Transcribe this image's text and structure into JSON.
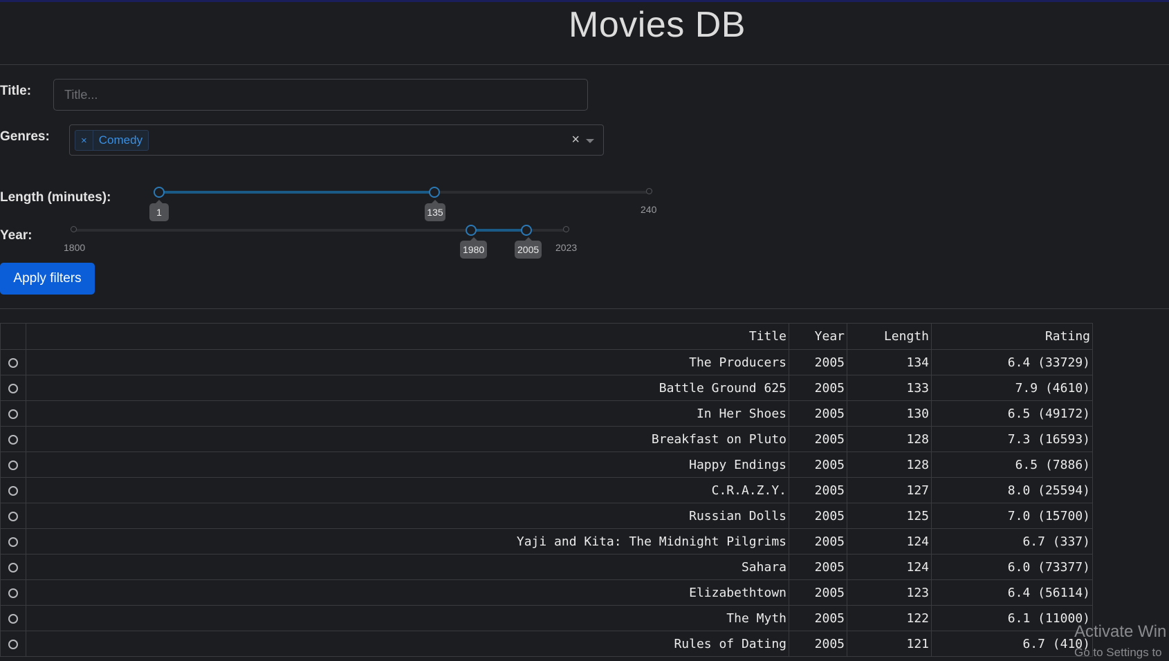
{
  "app": {
    "title": "Movies DB"
  },
  "filters": {
    "title_label": "Title:",
    "title_value": "",
    "title_placeholder": "Title...",
    "genres_label": "Genres:",
    "genres_selected": [
      "Comedy"
    ],
    "chip_remove_glyph": "×",
    "clear_glyph": "×",
    "length_label": "Length (minutes):",
    "length_min": "1",
    "length_max": "240",
    "length_range": [
      "1",
      "135"
    ],
    "year_label": "Year:",
    "year_min": "1800",
    "year_max": "2023",
    "year_range": [
      "1980",
      "2005"
    ],
    "apply_label": "Apply filters"
  },
  "table": {
    "columns": [
      "Title",
      "Year",
      "Length",
      "Rating"
    ],
    "rows": [
      [
        "The Producers",
        "2005",
        "134",
        "6.4 (33729)"
      ],
      [
        "Battle Ground 625",
        "2005",
        "133",
        "7.9 (4610)"
      ],
      [
        "In Her Shoes",
        "2005",
        "130",
        "6.5 (49172)"
      ],
      [
        "Breakfast on Pluto",
        "2005",
        "128",
        "7.3 (16593)"
      ],
      [
        "Happy Endings",
        "2005",
        "128",
        "6.5 (7886)"
      ],
      [
        "C.R.A.Z.Y.",
        "2005",
        "127",
        "8.0 (25594)"
      ],
      [
        "Russian Dolls",
        "2005",
        "125",
        "7.0 (15700)"
      ],
      [
        "Yaji and Kita: The Midnight Pilgrims",
        "2005",
        "124",
        "6.7 (337)"
      ],
      [
        "Sahara",
        "2005",
        "124",
        "6.0 (73377)"
      ],
      [
        "Elizabethtown",
        "2005",
        "123",
        "6.4 (56114)"
      ],
      [
        "The Myth",
        "2005",
        "122",
        "6.1 (11000)"
      ],
      [
        "Rules of Dating",
        "2005",
        "121",
        "6.7 (410)"
      ]
    ]
  },
  "watermark": {
    "line1": "Activate Win",
    "line2": "Go to Settings to"
  },
  "colors": {
    "accent": "#0b5ed7",
    "slider_track": "#1a5a86",
    "background": "#1c1d20"
  }
}
